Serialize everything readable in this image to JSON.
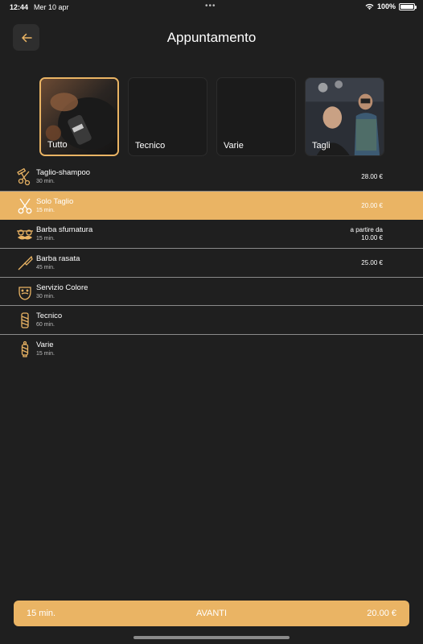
{
  "status_bar": {
    "time": "12:44",
    "date": "Mer 10 apr",
    "battery": "100%",
    "battery_level": 1.0
  },
  "header": {
    "title": "Appuntamento"
  },
  "categories": [
    {
      "label": "Tutto",
      "selected": true,
      "image": "barber-clipper-photo"
    },
    {
      "label": "Tecnico",
      "selected": false
    },
    {
      "label": "Varie",
      "selected": false
    },
    {
      "label": "Tagli",
      "selected": false,
      "image": "barber-shop-photo"
    }
  ],
  "services": [
    {
      "name": "Taglio-shampoo",
      "duration": "30 min.",
      "price": "28.00 €",
      "icon": "scissors-comb-icon"
    },
    {
      "name": "Solo Taglio",
      "duration": "15 min.",
      "price": "20.00 €",
      "icon": "scissors-icon",
      "selected": true
    },
    {
      "name": "Barba sfumatura",
      "duration": "15 min.",
      "price_prefix": "a partire da",
      "price": "10.00 €",
      "icon": "mustache-glasses-icon"
    },
    {
      "name": "Barba rasata",
      "duration": "45 min.",
      "price": "25.00 €",
      "icon": "razor-icon"
    },
    {
      "name": "Servizio Colore",
      "duration": "30 min.",
      "price": "",
      "icon": "bearded-face-icon"
    },
    {
      "name": "Tecnico",
      "duration": "60 min.",
      "price": "",
      "icon": "barber-pole-icon"
    },
    {
      "name": "Varie",
      "duration": "15 min.",
      "price": "",
      "icon": "barber-pole-icon"
    }
  ],
  "footer": {
    "duration": "15 min.",
    "label": "AVANTI",
    "total": "20.00 €"
  },
  "colors": {
    "accent": "#eab464",
    "background": "#1f1f1f"
  }
}
